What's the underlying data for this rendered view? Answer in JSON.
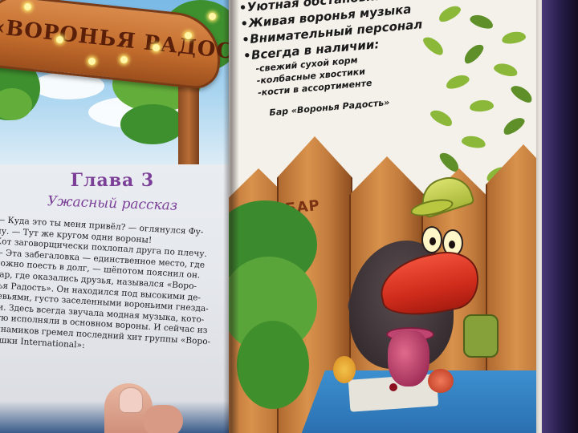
{
  "left_page": {
    "sign_text": "«ВОРОНЬЯ РАДОСТЬ»",
    "chapter_title": "Глава 3",
    "chapter_subtitle": "Ужасный рассказ",
    "story_lines": [
      "— Куда это ты меня привёл? — оглянулся Фу-",
      "ну. — Тут же кругом одни вороны!",
      "  Кот заговорщически похлопал друга по плечу.",
      "— Эта забегаловка — единственное место, где",
      "можно поесть в долг, — шёпотом пояснил он.",
      "  Бар, где оказались друзья, назывался «Воро-",
      "нья Радость». Он находился под высокими де-",
      "ревьями, густо заселенными вороньими гнезда-",
      "ми. Здесь всегда звучала модная музыка, кото-",
      "рую исполняли в основном вороны. И сейчас из",
      "динамиков гремел последний хит группы «Воро-",
      "тушки International»:"
    ]
  },
  "right_page": {
    "ad_items": [
      "Уютная обстановка",
      "Живая воронья музыка",
      "Внимательный персонал",
      "Всегда в наличии:"
    ],
    "ad_subitems": [
      "-свежий сухой корм",
      "-колбасные хвостики",
      "-кости в ассортименте"
    ],
    "ad_footer": "Бар «Воронья Радость»",
    "fence_word": "БАР"
  }
}
